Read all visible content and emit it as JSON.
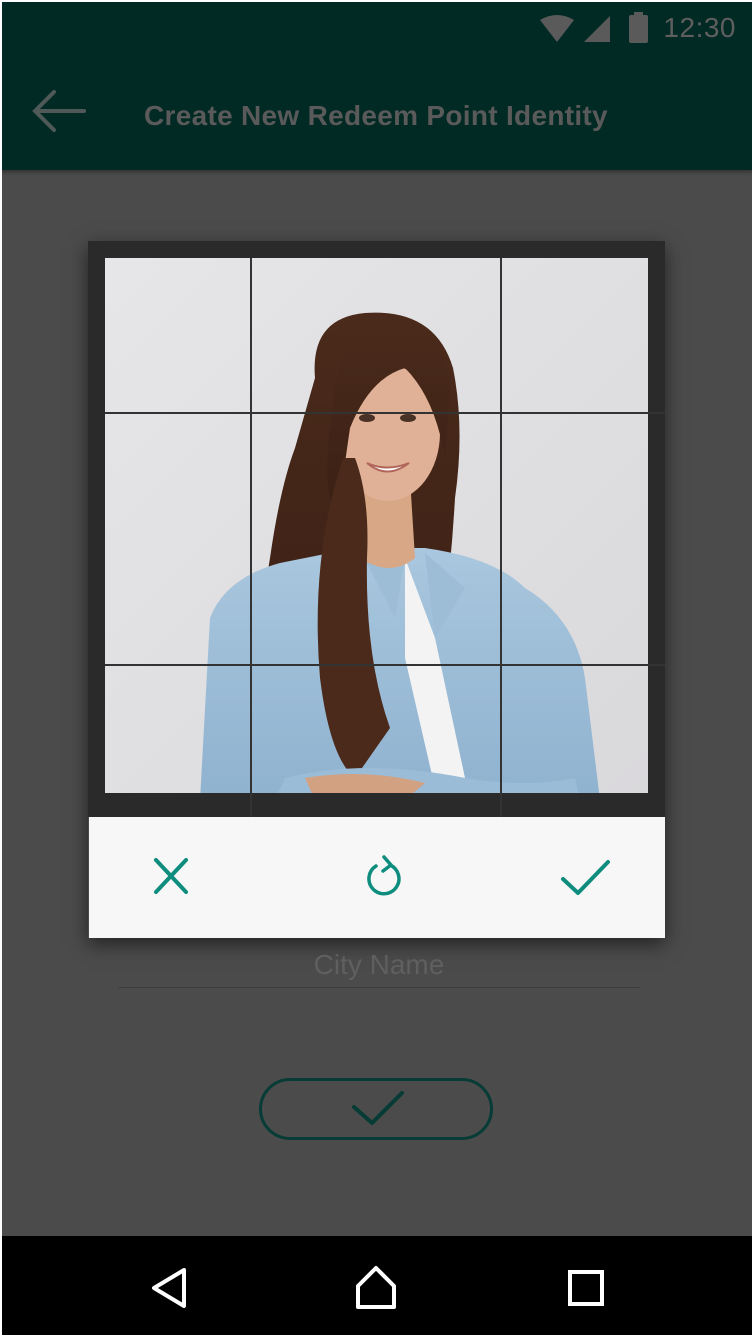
{
  "status_bar": {
    "time": "12:30",
    "icons": [
      "wifi-icon",
      "cell-signal-icon",
      "battery-icon"
    ]
  },
  "app_bar": {
    "title": "Create New Redeem Point Identity",
    "back_icon": "arrow-back-icon"
  },
  "cropper": {
    "image": "portrait-photo",
    "grid": "3x3",
    "actions": {
      "cancel_icon": "close-icon",
      "rotate_icon": "rotate-icon",
      "confirm_icon": "check-icon"
    }
  },
  "form": {
    "city_placeholder": "City Name",
    "city_value": "",
    "submit_icon": "check-icon"
  },
  "nav_bar": {
    "icons": [
      "nav-back-icon",
      "nav-home-icon",
      "nav-recents-icon"
    ]
  },
  "colors": {
    "app_bar": "#022a25",
    "accent": "#0e8d7f",
    "overlay": "#4b4b4b"
  }
}
